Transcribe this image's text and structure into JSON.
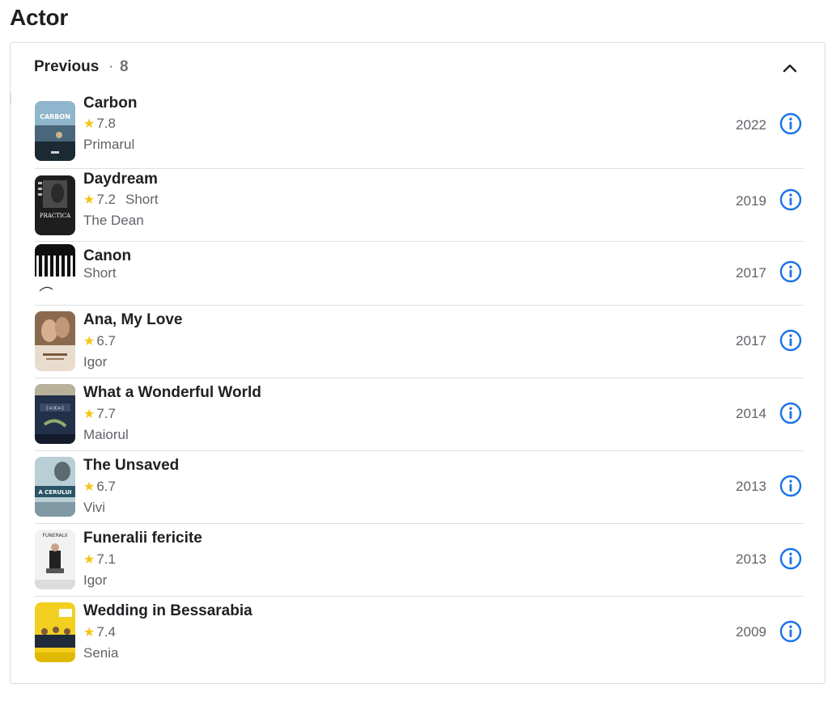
{
  "section": {
    "title": "Actor"
  },
  "header": {
    "label": "Previous",
    "separator": "·",
    "count": "8",
    "chevron_icon": "chevron-up-icon"
  },
  "colors": {
    "accent": "#1a73e8",
    "star": "#f5c518",
    "muted": "#5f6368"
  },
  "credits": [
    {
      "title": "Carbon",
      "rating": "7.8",
      "kind": "",
      "role": "Primarul",
      "year": "2022"
    },
    {
      "title": "Daydream",
      "rating": "7.2",
      "kind": "Short",
      "role": "The Dean",
      "year": "2019"
    },
    {
      "title": "Canon",
      "rating": "",
      "kind": "Short",
      "role": "",
      "year": "2017"
    },
    {
      "title": "Ana, My Love",
      "rating": "6.7",
      "kind": "",
      "role": "Igor",
      "year": "2017"
    },
    {
      "title": "What a Wonderful World",
      "rating": "7.7",
      "kind": "",
      "role": "Maiorul",
      "year": "2014"
    },
    {
      "title": "The Unsaved",
      "rating": "6.7",
      "kind": "",
      "role": "Vivi",
      "year": "2013"
    },
    {
      "title": "Funeralii fericite",
      "rating": "7.1",
      "kind": "",
      "role": "Igor",
      "year": "2013"
    },
    {
      "title": "Wedding in Bessarabia",
      "rating": "7.4",
      "kind": "",
      "role": "Senia",
      "year": "2009"
    }
  ]
}
